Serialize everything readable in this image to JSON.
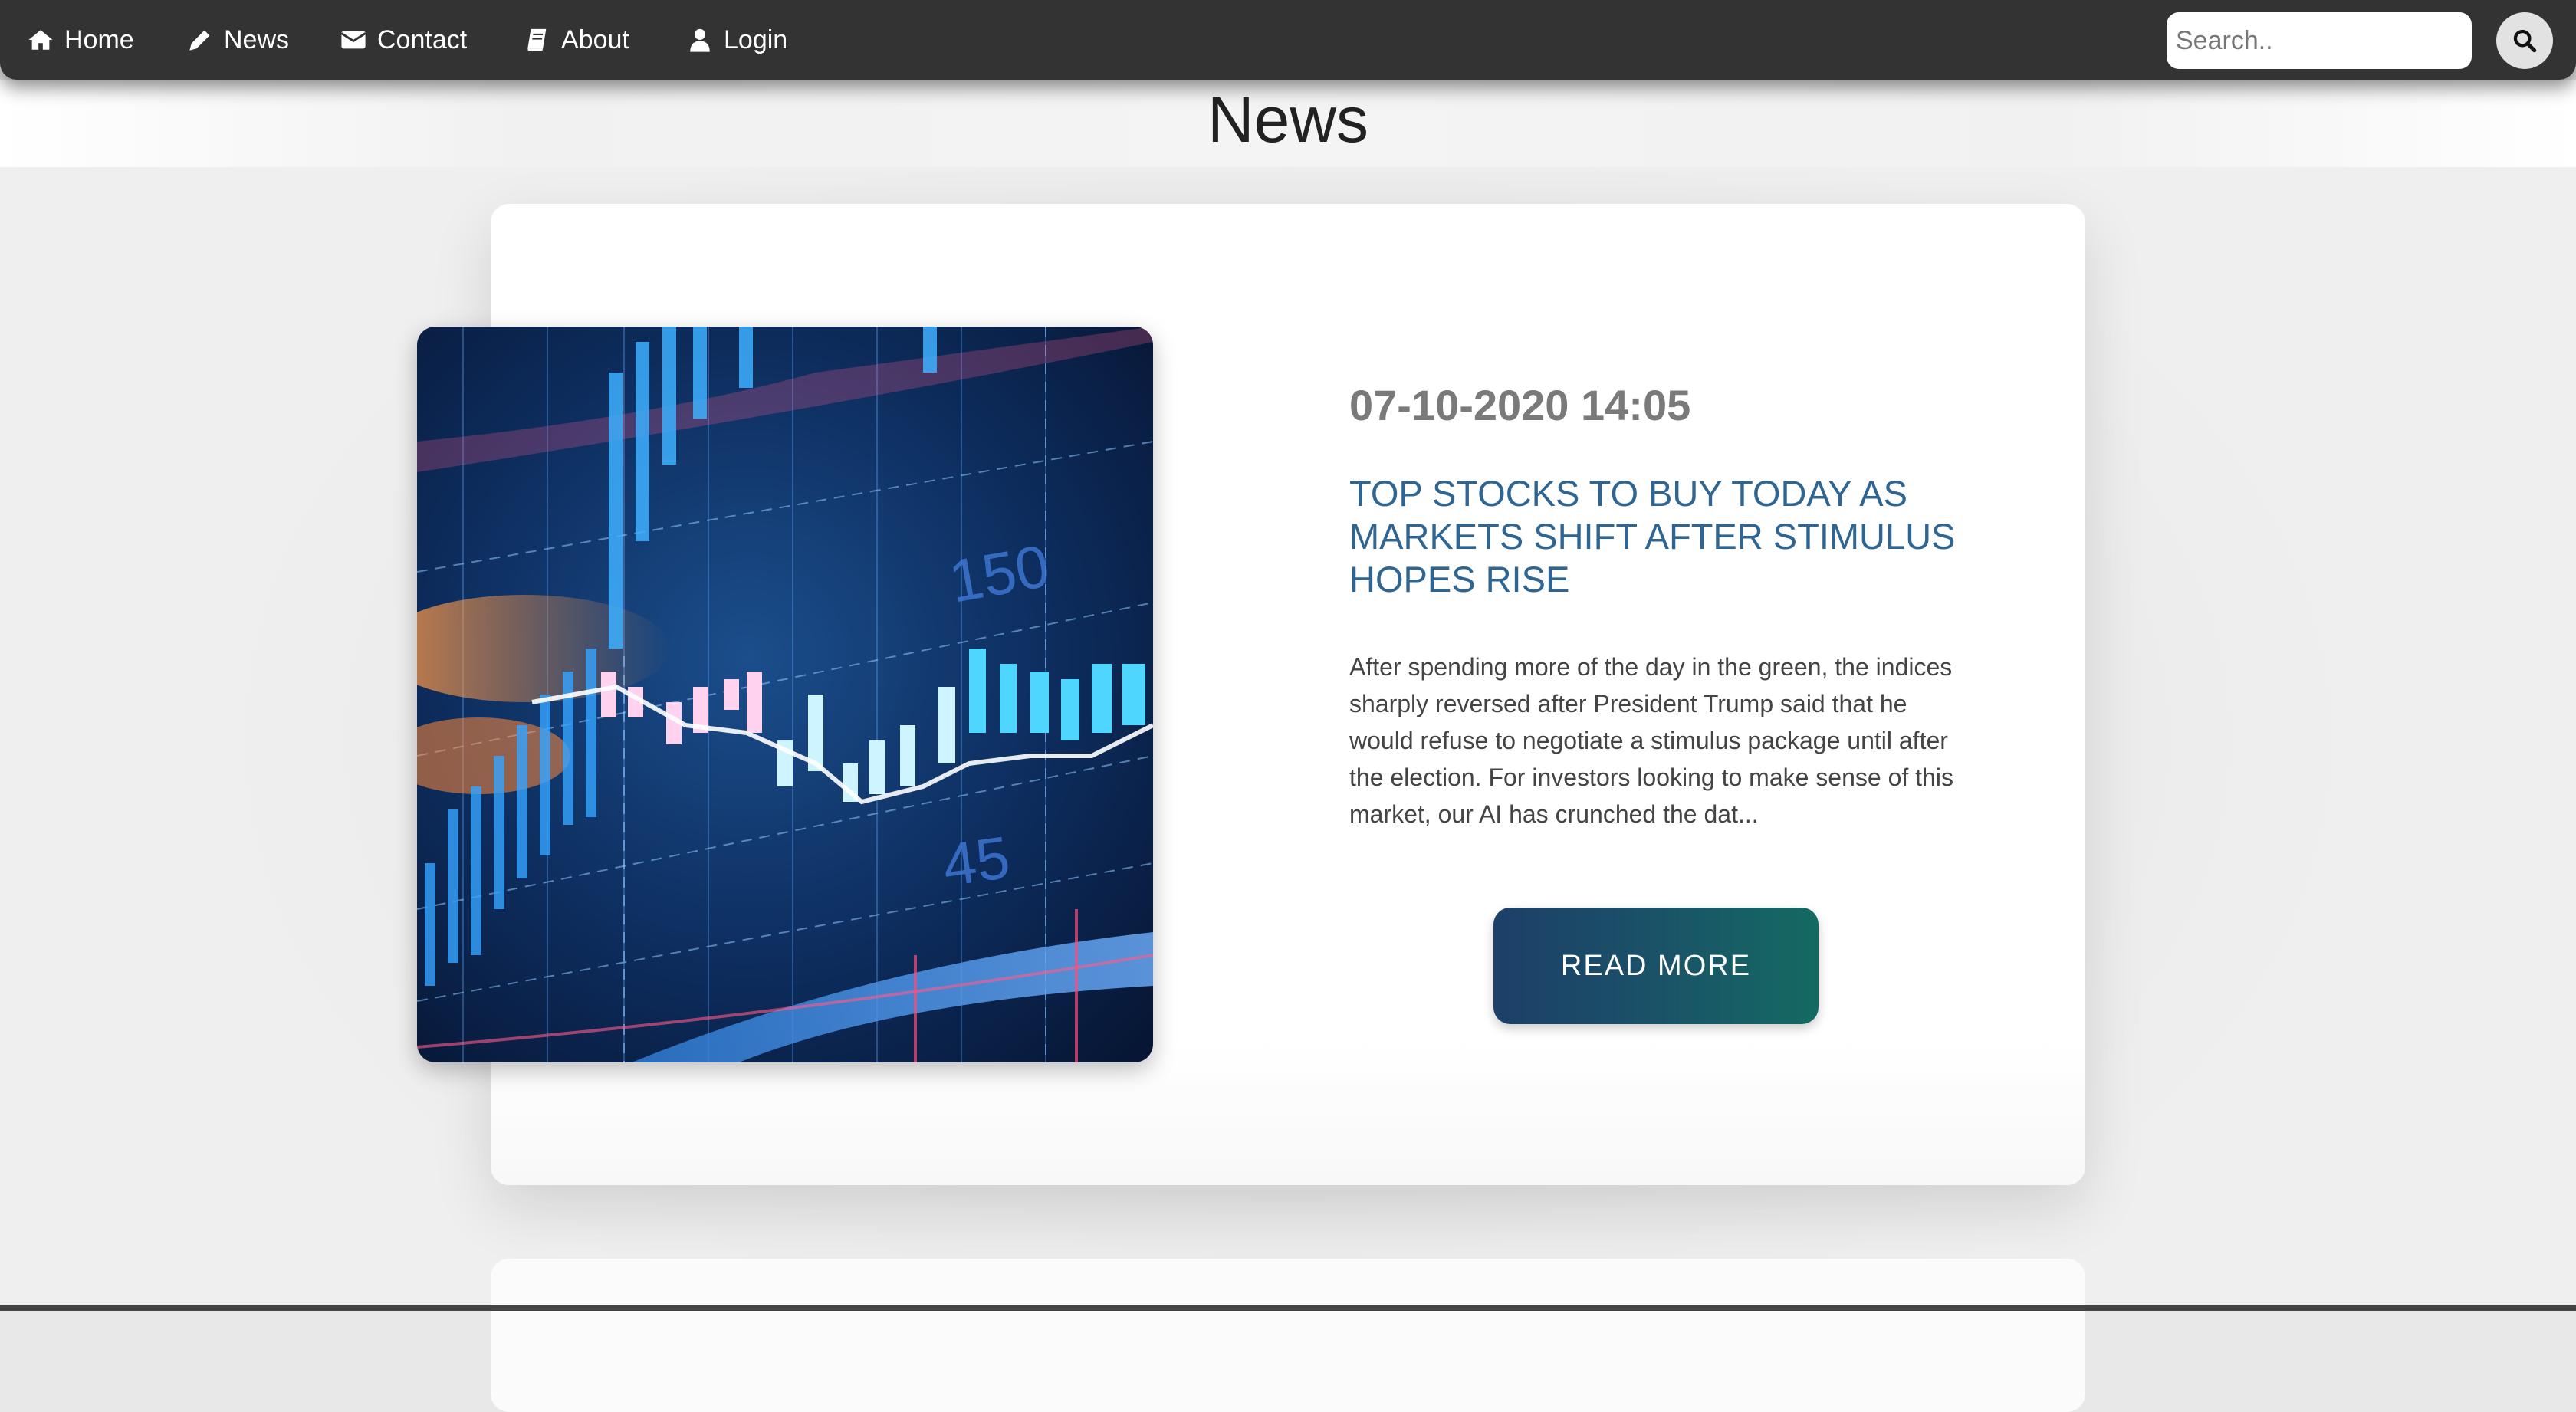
{
  "nav": {
    "items": [
      {
        "label": "Home",
        "icon": "home-icon"
      },
      {
        "label": "News",
        "icon": "pencil-icon"
      },
      {
        "label": "Contact",
        "icon": "envelope-icon"
      },
      {
        "label": "About",
        "icon": "book-icon"
      },
      {
        "label": "Login",
        "icon": "user-icon"
      }
    ],
    "search": {
      "placeholder": "Search..",
      "value": "",
      "button_icon": "search-icon"
    }
  },
  "page": {
    "title": "News"
  },
  "articles": [
    {
      "image": "stock-chart-image",
      "date": "07-10-2020 14:05",
      "headline": "TOP STOCKS TO BUY TODAY AS MARKETS SHIFT AFTER STIMULUS HOPES RISE",
      "excerpt": "After spending more of the day in the green, the indices sharply reversed after President Trump said that he would refuse to negotiate a stimulus package until after the election. For investors looking to make sense of this market, our AI has crunched the dat...",
      "button_label": "READ MORE"
    }
  ],
  "colors": {
    "navbar": "#333333",
    "headline": "#2f6592",
    "button_start": "#1d3f68",
    "button_end": "#146a62"
  }
}
